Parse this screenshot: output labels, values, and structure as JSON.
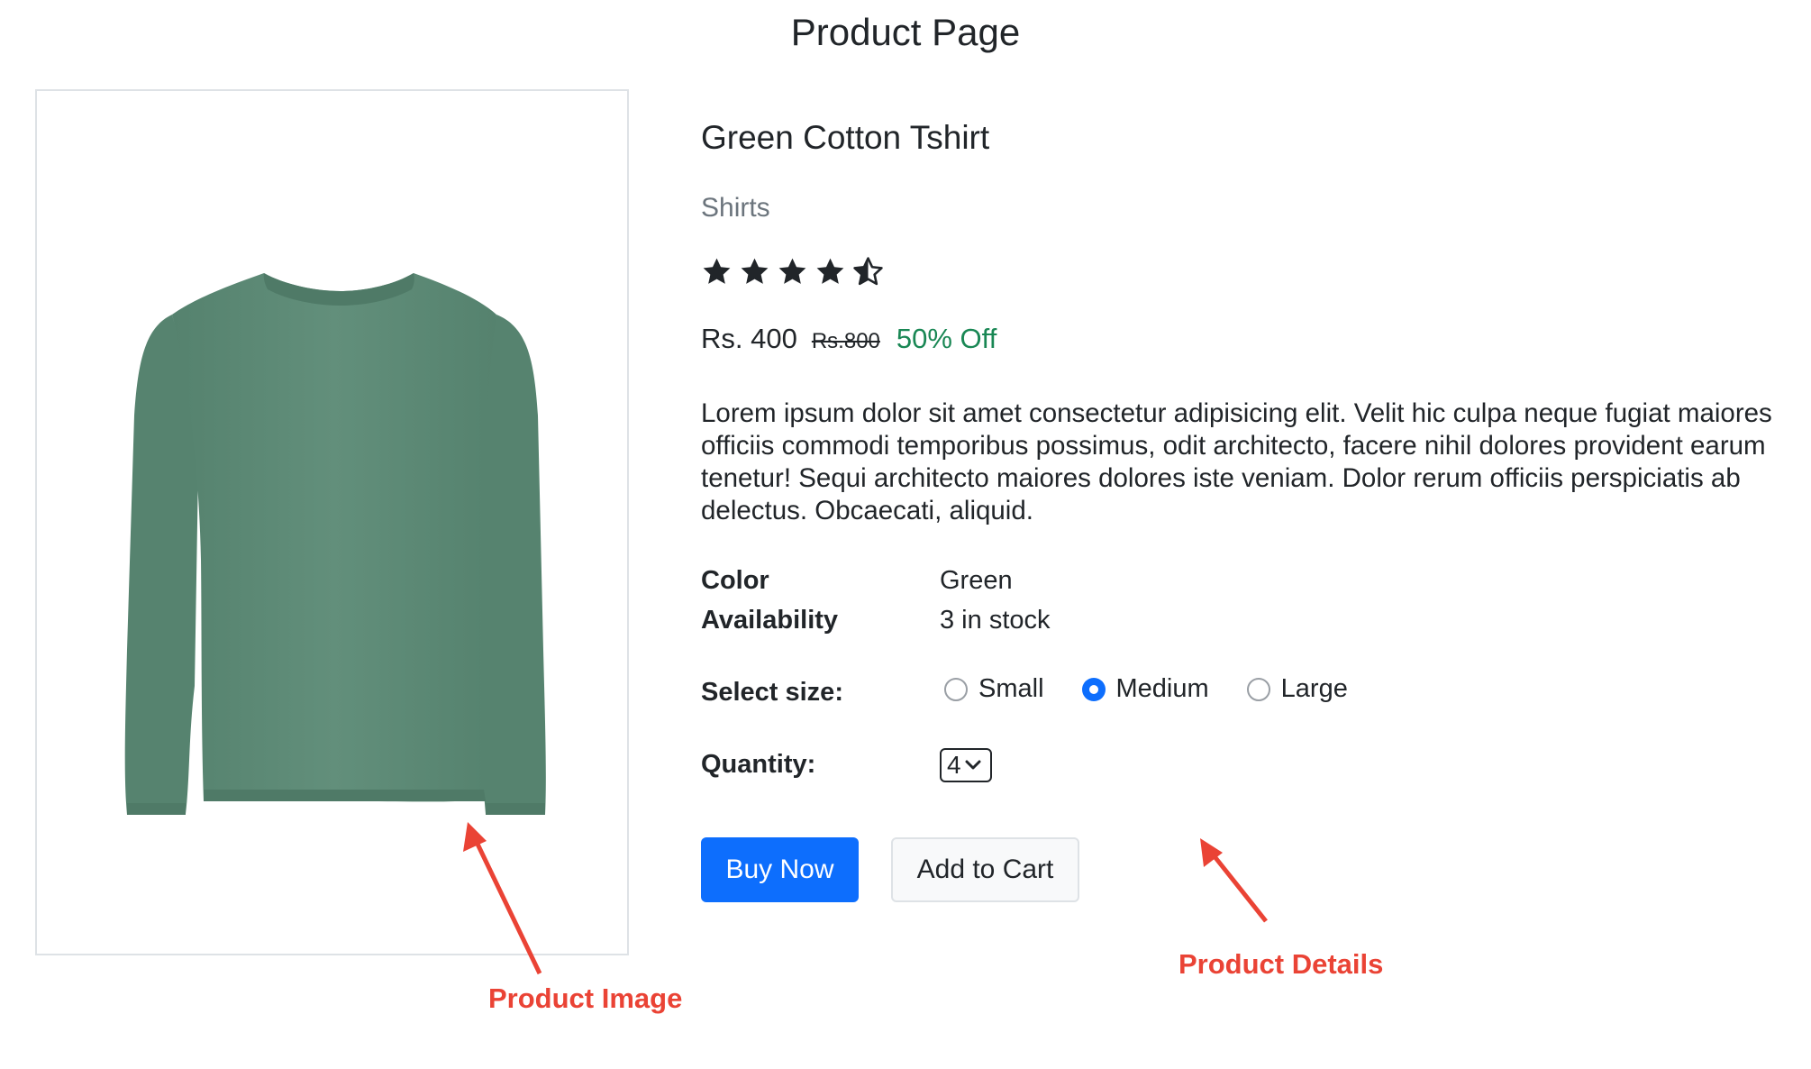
{
  "page": {
    "title": "Product Page"
  },
  "product": {
    "name": "Green Cotton Tshirt",
    "category": "Shirts",
    "rating": 4.5,
    "rating_max": 5,
    "price": "Rs. 400",
    "original_price": "Rs.800",
    "discount": "50% Off",
    "description": "Lorem ipsum dolor sit amet consectetur adipisicing elit. Velit hic culpa neque fugiat maiores officiis commodi temporibus possimus, odit architecto, facere nihil dolores provident earum tenetur! Sequi architecto maiores dolores iste veniam. Dolor rerum officiis perspiciatis ab delectus. Obcaecati, aliquid.",
    "image_icon": "green-long-sleeve-tshirt-image"
  },
  "attributes": {
    "color_label": "Color",
    "color_value": "Green",
    "availability_label": "Availability",
    "availability_value": "3 in stock"
  },
  "size": {
    "label": "Select size:",
    "options": [
      "Small",
      "Medium",
      "Large"
    ],
    "selected": "Medium"
  },
  "quantity": {
    "label": "Quantity:",
    "value": "4"
  },
  "actions": {
    "buy_now": "Buy Now",
    "add_to_cart": "Add to Cart"
  },
  "annotations": {
    "product_image": "Product Image",
    "product_details": "Product Details"
  },
  "colors": {
    "primary": "#0d6efd",
    "discount": "#198754",
    "muted": "#6c757d",
    "annotation": "#ea4335",
    "shirt": "#5e8c78"
  }
}
